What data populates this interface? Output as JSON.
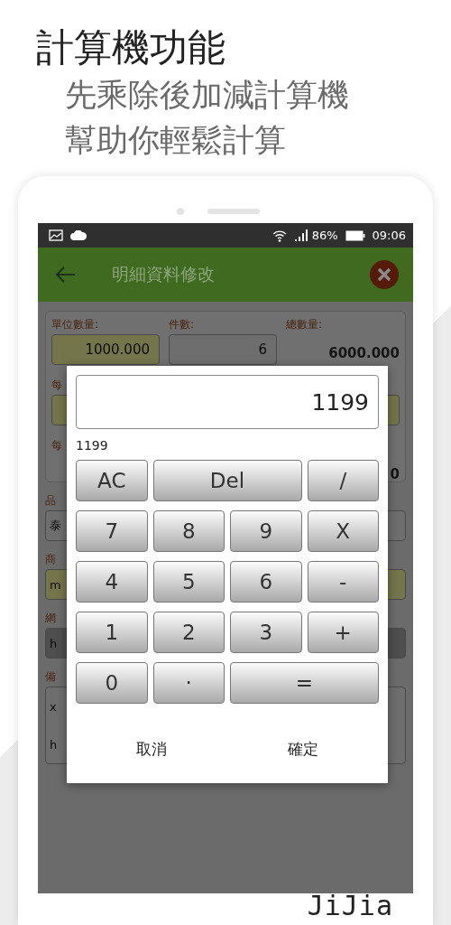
{
  "promo": {
    "title": "計算機功能",
    "subtitle_lines": [
      "先乘除後加減計算機",
      "幫助你輕鬆計算"
    ]
  },
  "status_bar": {
    "battery": "86%",
    "time": "09:06"
  },
  "app_bar": {
    "title": "明細資料修改"
  },
  "form": {
    "top_fields": [
      {
        "label": "單位數量:",
        "value": "1000.000",
        "kind": "input"
      },
      {
        "label": "件數:",
        "value": "6",
        "kind": "input"
      },
      {
        "label": "總數量:",
        "value": "6000.000",
        "kind": "text"
      }
    ],
    "card_rows": [
      {
        "label": "每",
        "kind": "input"
      },
      {
        "label": "每",
        "value": "0",
        "kind": "text"
      }
    ],
    "rows": [
      {
        "label": "品",
        "value": "泰",
        "kind": "input"
      },
      {
        "label": "商",
        "value": "m",
        "kind": "select"
      },
      {
        "label": "網",
        "value": "h",
        "kind": "link"
      },
      {
        "label": "備",
        "lines": [
          "x",
          "h"
        ],
        "kind": "memo"
      }
    ]
  },
  "calculator": {
    "display": "1199",
    "expression": "1199",
    "keys": [
      {
        "label": "AC",
        "kind": "normal"
      },
      {
        "label": "Del",
        "kind": "wide"
      },
      {
        "label": "/",
        "kind": "normal"
      },
      {
        "label": "7",
        "kind": "normal"
      },
      {
        "label": "8",
        "kind": "normal"
      },
      {
        "label": "9",
        "kind": "normal"
      },
      {
        "label": "X",
        "kind": "normal"
      },
      {
        "label": "4",
        "kind": "normal"
      },
      {
        "label": "5",
        "kind": "normal"
      },
      {
        "label": "6",
        "kind": "normal"
      },
      {
        "label": "-",
        "kind": "normal"
      },
      {
        "label": "1",
        "kind": "normal"
      },
      {
        "label": "2",
        "kind": "normal"
      },
      {
        "label": "3",
        "kind": "normal"
      },
      {
        "label": "+",
        "kind": "normal"
      },
      {
        "label": "0",
        "kind": "normal"
      },
      {
        "label": "·",
        "kind": "normal"
      },
      {
        "label": "=",
        "kind": "wide"
      }
    ],
    "buttons": [
      "取消",
      "確定"
    ]
  },
  "logo": "JiJia"
}
